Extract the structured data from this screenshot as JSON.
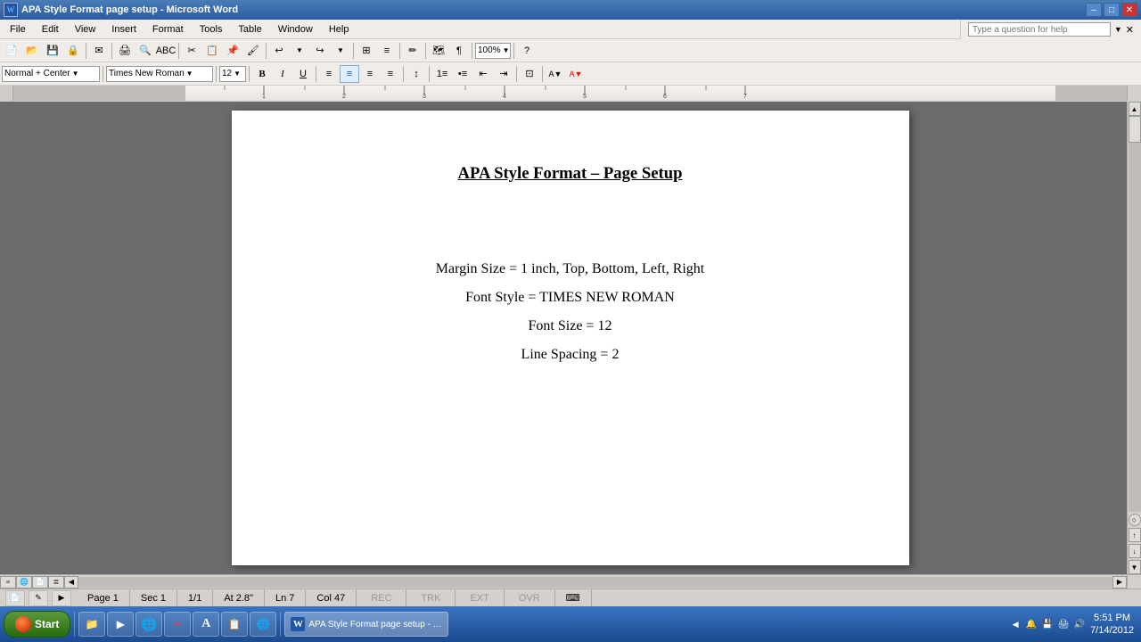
{
  "titleBar": {
    "title": "APA Style Format page setup - Microsoft Word",
    "icon": "W",
    "minimize": "–",
    "maximize": "□",
    "close": "✕"
  },
  "menuBar": {
    "items": [
      "File",
      "Edit",
      "View",
      "Insert",
      "Format",
      "Tools",
      "Table",
      "Window",
      "Help"
    ]
  },
  "toolbar1": {
    "styleLabel": "Normal + Center",
    "fontLabel": "Times New Roman",
    "sizeLabel": "12",
    "boldLabel": "B",
    "italicLabel": "I",
    "underlineLabel": "U"
  },
  "toolbar2": {
    "helpText": "Type a question for help",
    "zoomLabel": "100%"
  },
  "document": {
    "title": "APA Style Format – Page Setup",
    "lines": [
      "Margin Size = 1 inch, Top, Bottom, Left, Right",
      "Font Style = TIMES NEW ROMAN",
      "Font Size = 12",
      "Line Spacing = 2"
    ]
  },
  "statusBar": {
    "page": "Page 1",
    "sec": "Sec 1",
    "pageOf": "1/1",
    "at": "At 2.8\"",
    "ln": "Ln 7",
    "col": "Col 47",
    "rec": "REC",
    "trk": "TRK",
    "ext": "EXT",
    "ovr": "OVR"
  },
  "taskbar": {
    "startLabel": "Start",
    "apps": [
      {
        "icon": "📁",
        "label": ""
      },
      {
        "icon": "▶",
        "label": ""
      },
      {
        "icon": "🌐",
        "label": ""
      },
      {
        "icon": "✂",
        "label": ""
      },
      {
        "icon": "A",
        "label": ""
      },
      {
        "icon": "📋",
        "label": ""
      },
      {
        "icon": "🌐",
        "label": ""
      },
      {
        "icon": "W",
        "label": "APA Style Format page setup - Microsoft Word"
      }
    ],
    "time": "5:51 PM",
    "date": "7/14/2012"
  }
}
